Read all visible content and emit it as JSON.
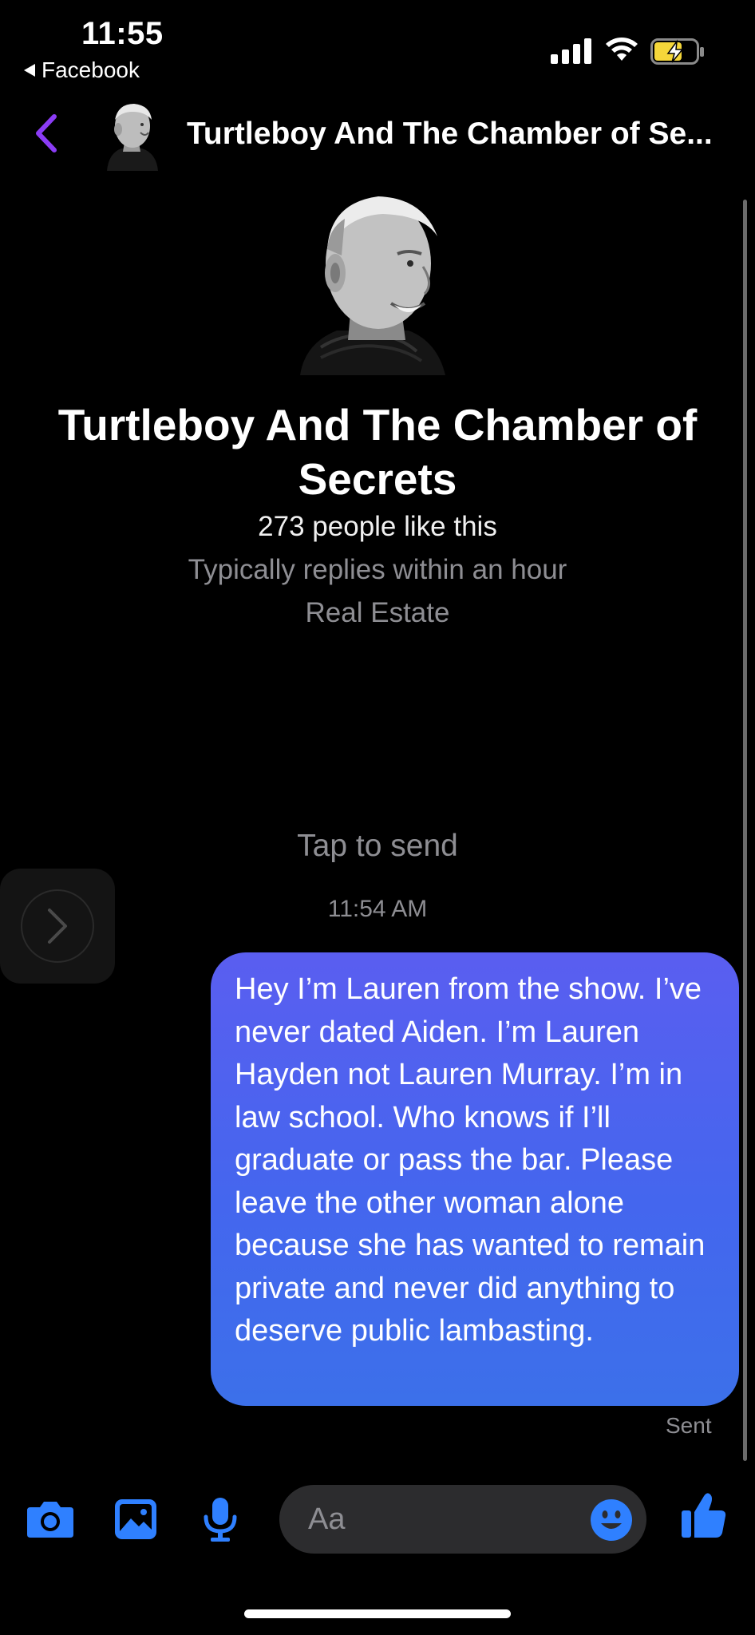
{
  "status_bar": {
    "time": "11:55",
    "back_app": "Facebook"
  },
  "header": {
    "title": "Turtleboy And The Chamber of Se..."
  },
  "profile": {
    "name": "Turtleboy And The Chamber of Secrets",
    "likes": "273 people like this",
    "response_time": "Typically replies within an hour",
    "category": "Real Estate"
  },
  "conversation": {
    "tap_to_send": "Tap to send",
    "timestamp": "11:54 AM",
    "message": "Hey I’m Lauren from the show. I’ve never dated Aiden. I’m Lauren Hayden not Lauren Murray. I’m in law school. Who knows if I’ll graduate or pass the bar. Please leave the other woman alone because she has wanted to remain private and never did anything to deserve public lambasting.",
    "status": "Sent"
  },
  "composer": {
    "placeholder": "Aa"
  },
  "colors": {
    "accent_purple": "#8b3cf5",
    "accent_blue": "#2f80ff",
    "bubble_top": "#5a5ef0",
    "bubble_bottom": "#3c70ea",
    "battery": "#f5d73a"
  },
  "icons": [
    "back-chevron-icon",
    "signal-icon",
    "wifi-icon",
    "battery-charging-icon",
    "camera-icon",
    "photo-icon",
    "microphone-icon",
    "emoji-icon",
    "thumbs-up-icon",
    "chevron-right-icon"
  ]
}
